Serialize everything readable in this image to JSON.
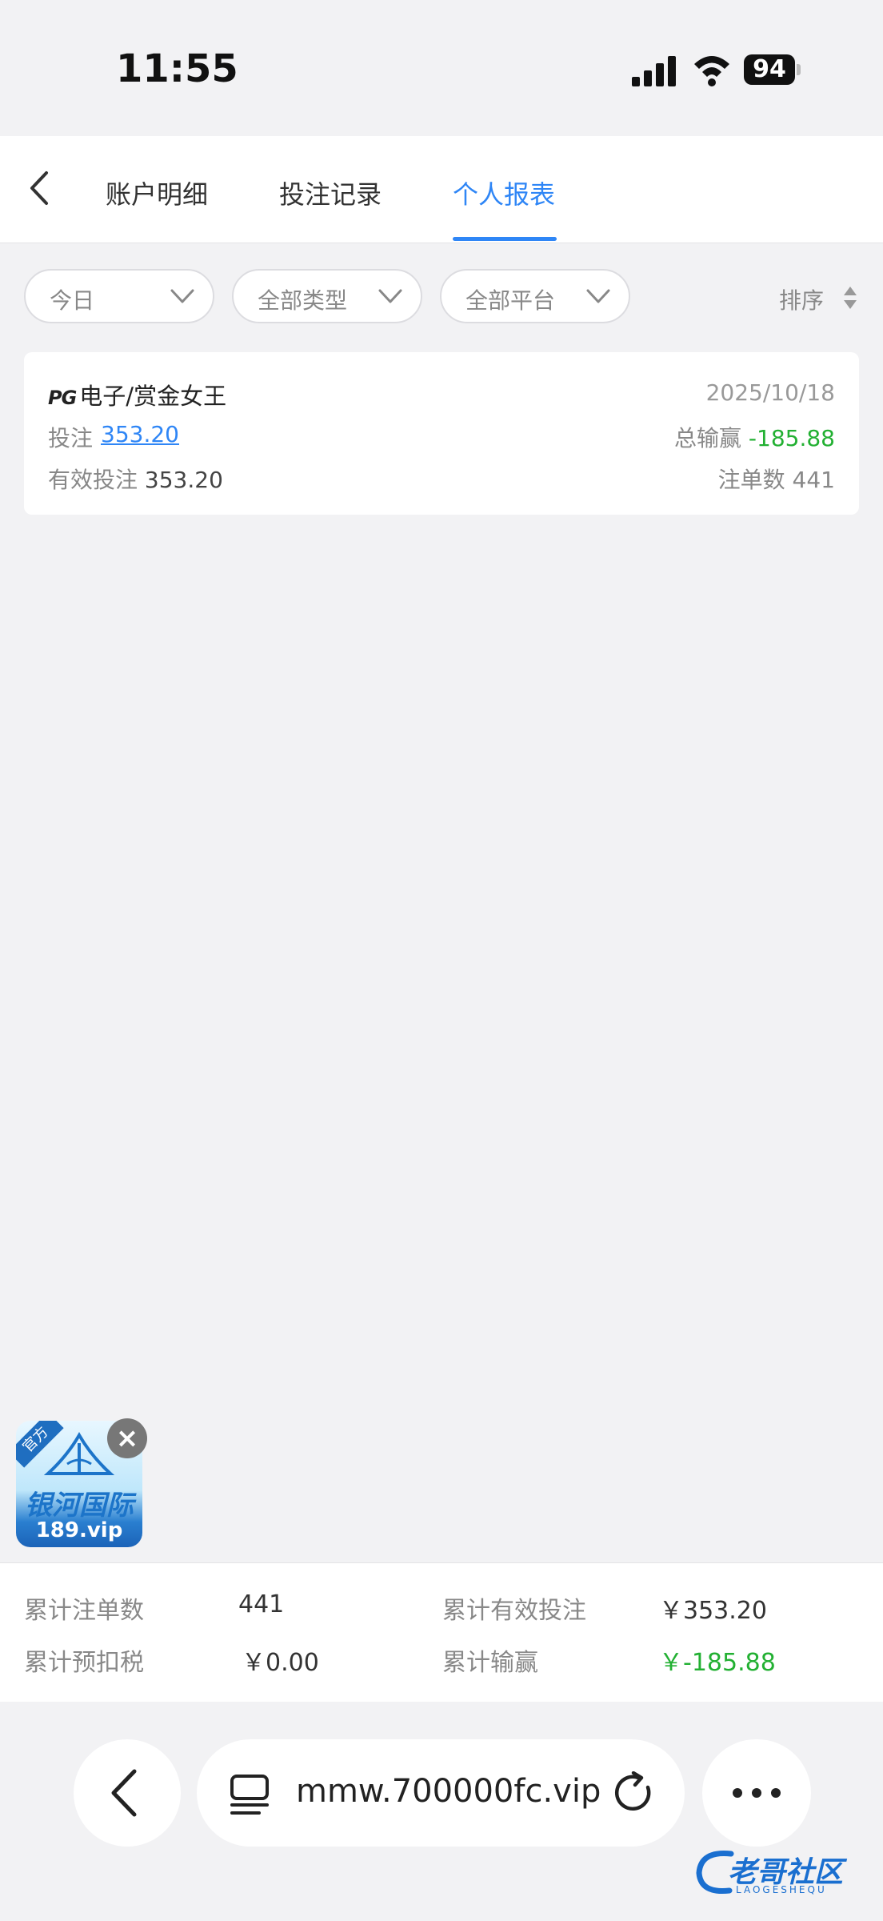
{
  "status_bar": {
    "time": "11:55",
    "battery": "94"
  },
  "header": {
    "tabs": [
      {
        "label": "账户明细"
      },
      {
        "label": "投注记录"
      },
      {
        "label": "个人报表"
      }
    ],
    "active_tab": "个人报表"
  },
  "filters": {
    "date": "今日",
    "type": "全部类型",
    "platform": "全部平台",
    "sort_label": "排序"
  },
  "record": {
    "platform_logo": "PG",
    "game": "电子/赏金女王",
    "date": "2025/10/18",
    "bet_label": "投注",
    "bet_value": "353.20",
    "win_label": "总输赢",
    "win_value": "-185.88",
    "valid_label": "有效投注",
    "valid_value": "353.20",
    "count_label": "注单数",
    "count_value": "441"
  },
  "promo": {
    "ribbon": "官方",
    "brand": "银河国际",
    "site": "189.vip",
    "close_icon": "close-icon"
  },
  "summary": {
    "total_bets_label": "累计注单数",
    "total_bets_value": "441",
    "total_valid_label": "累计有效投注",
    "total_valid_value": "￥353.20",
    "total_tax_label": "累计预扣税",
    "total_tax_value": "￥0.00",
    "total_win_label": "累计输赢",
    "total_win_value": "￥-185.88",
    "win_color": "#22b032"
  },
  "browser": {
    "url": "mmw.700000fc.vip"
  },
  "watermark": {
    "text": "老哥社区",
    "sub": "LAOGESHEQU"
  },
  "colors": {
    "accent": "#2f86f6",
    "negative": "#22b032"
  }
}
